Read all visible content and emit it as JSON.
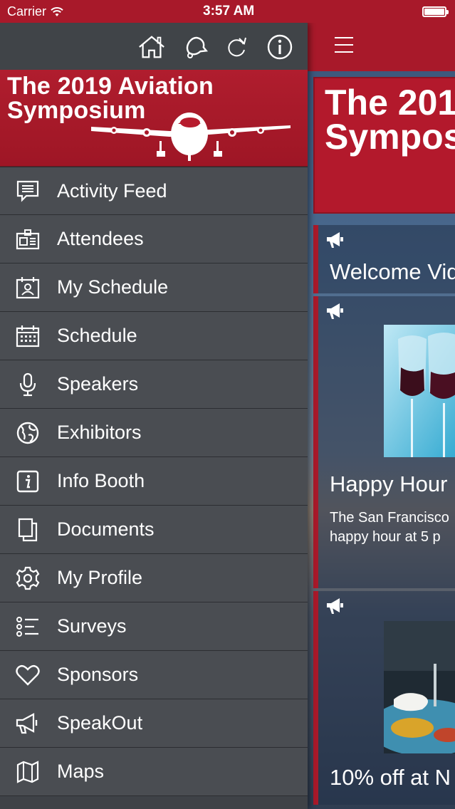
{
  "status_bar": {
    "carrier": "Carrier",
    "time": "3:57 AM"
  },
  "drawer": {
    "toolbar_icons": [
      "home-icon",
      "bell-icon",
      "refresh-icon",
      "info-icon"
    ],
    "banner": {
      "title_line1": "The 2019 Aviation",
      "title_line2": "Symposium"
    },
    "menu": [
      {
        "label": "Activity Feed",
        "icon": "activity-feed-icon"
      },
      {
        "label": "Attendees",
        "icon": "attendees-icon"
      },
      {
        "label": "My Schedule",
        "icon": "my-schedule-icon"
      },
      {
        "label": "Schedule",
        "icon": "calendar-icon"
      },
      {
        "label": "Speakers",
        "icon": "microphone-icon"
      },
      {
        "label": "Exhibitors",
        "icon": "globe-icon"
      },
      {
        "label": "Info Booth",
        "icon": "info-booth-icon"
      },
      {
        "label": "Documents",
        "icon": "documents-icon"
      },
      {
        "label": "My Profile",
        "icon": "gear-icon"
      },
      {
        "label": "Surveys",
        "icon": "list-icon"
      },
      {
        "label": "Sponsors",
        "icon": "heart-icon"
      },
      {
        "label": "SpeakOut",
        "icon": "megaphone-icon"
      },
      {
        "label": "Maps",
        "icon": "map-icon"
      }
    ]
  },
  "content": {
    "banner": {
      "title_line1": "The 201",
      "title_line2": "Sympos"
    },
    "cards": [
      {
        "title": "Welcome Vid",
        "body_line1": "",
        "body_line2": ""
      },
      {
        "title": "Happy Hour",
        "body_line1": "The San Francisco",
        "body_line2": "happy hour at 5 p"
      },
      {
        "title": "10% off at N",
        "body_line1": "",
        "body_line2": ""
      }
    ]
  },
  "colors": {
    "brand_red": "#a8192a",
    "drawer_bg": "#4a4d52",
    "text": "#ffffff"
  }
}
